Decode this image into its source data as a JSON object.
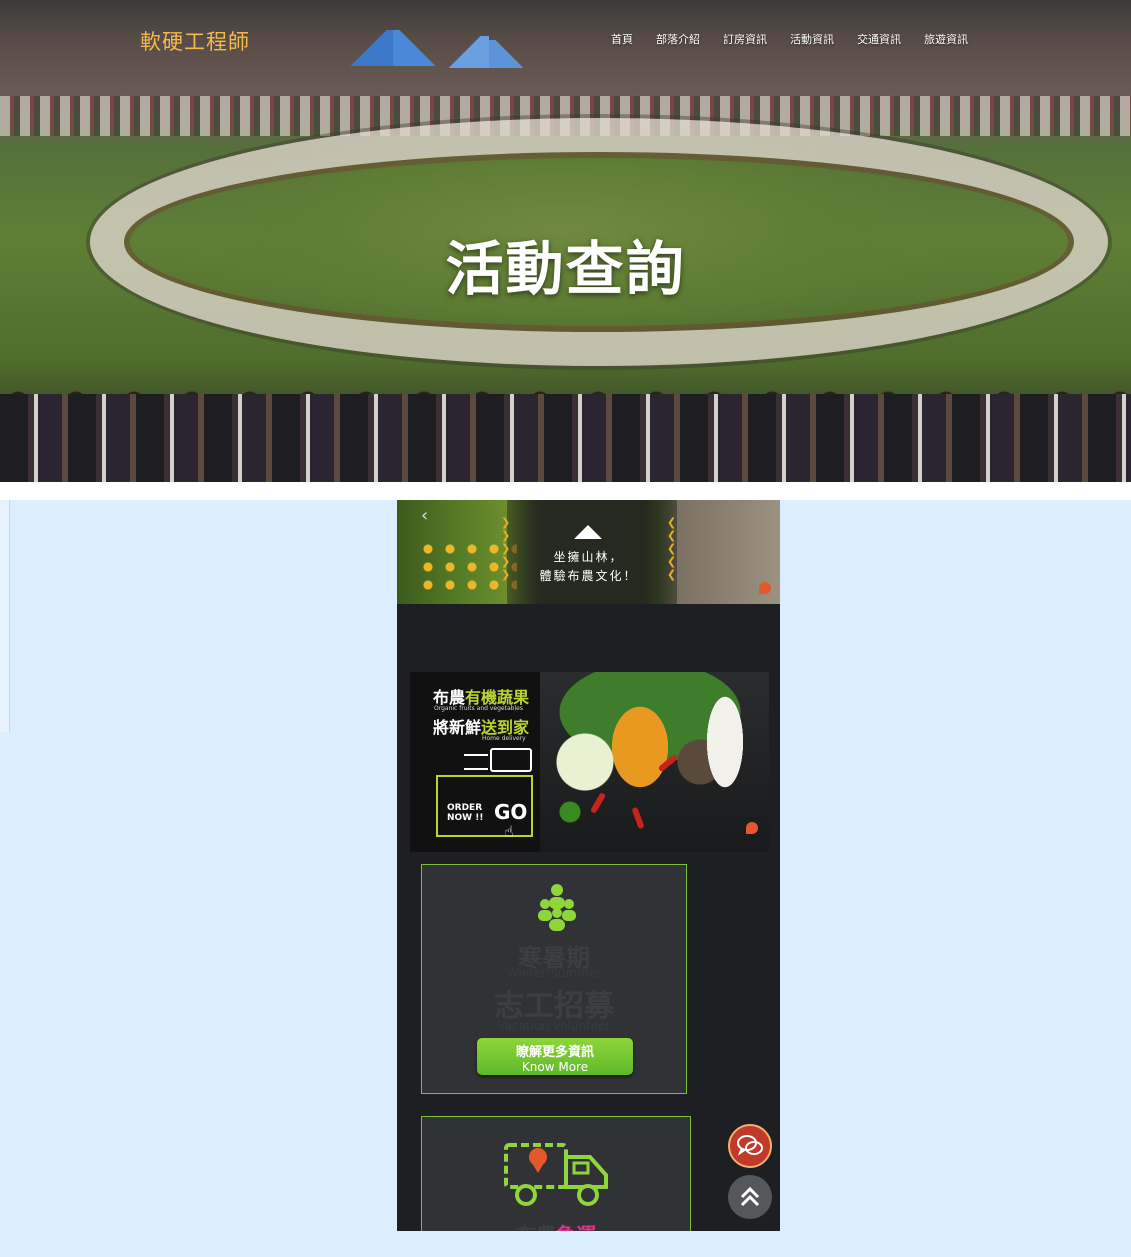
{
  "header": {
    "brand": "軟硬工程師",
    "nav": [
      "首頁",
      "部落介紹",
      "訂房資訊",
      "活動資訊",
      "交通資訊",
      "旅遊資訊"
    ]
  },
  "hero": {
    "title": "活動查詢"
  },
  "phone": {
    "banner1": {
      "line1": "坐擁山林，",
      "line2": "體驗布農文化！"
    },
    "banner2": {
      "title1_a": "布農",
      "title1_b": "有機蔬果",
      "sub1": "Organic fruits and vegetables",
      "title2_a": "將新鮮",
      "title2_b": "送到家",
      "sub2": "Home delivery",
      "order": "ORDER NOW !!",
      "go": "GO"
    },
    "card1": {
      "t1": "寒暑期",
      "t2": "Winter/Summer",
      "t3": "志工招募",
      "t4": "Vacation Volunteer",
      "button_zh": "瞭解更多資訊",
      "button_en": "Know More"
    },
    "card2": {
      "partial_a": "布農",
      "partial_b": "急運"
    }
  },
  "colors": {
    "brand": "#f5b84a",
    "accent_green": "#7fbf3a",
    "page_bg": "#dbeefd",
    "chat": "#c0392b"
  },
  "icons": {
    "chat": "chat-bubbles-icon",
    "top": "double-chevron-up-icon",
    "people": "people-group-icon",
    "truck": "delivery-truck-icon",
    "mountain": "mountain-icon"
  }
}
